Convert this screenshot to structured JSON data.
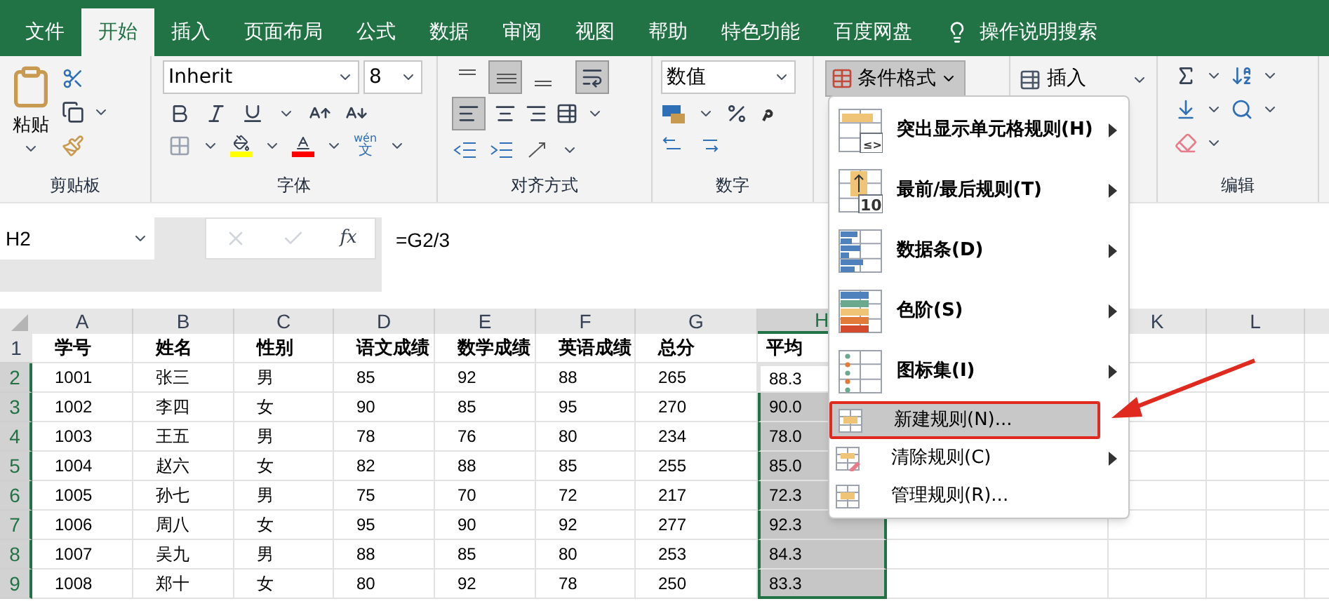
{
  "tabs": [
    {
      "label": "文件",
      "selected": false
    },
    {
      "label": "开始",
      "selected": true
    },
    {
      "label": "插入",
      "selected": false
    },
    {
      "label": "页面布局",
      "selected": false
    },
    {
      "label": "公式",
      "selected": false
    },
    {
      "label": "数据",
      "selected": false
    },
    {
      "label": "审阅",
      "selected": false
    },
    {
      "label": "视图",
      "selected": false
    },
    {
      "label": "帮助",
      "selected": false
    },
    {
      "label": "特色功能",
      "selected": false
    },
    {
      "label": "百度网盘",
      "selected": false
    }
  ],
  "search_hint": "操作说明搜索",
  "ribbon": {
    "clipboard": {
      "paste": "粘贴",
      "label": "剪贴板"
    },
    "font": {
      "name": "Inherit",
      "size": "8",
      "label": "字体",
      "phonetic_top": "wén",
      "phonetic_bottom": "文"
    },
    "alignment": {
      "label": "对齐方式"
    },
    "number": {
      "format": "数值",
      "label": "数字"
    },
    "styles": {
      "conditional_format": "条件格式",
      "open": true
    },
    "cells": {
      "insert": "插入"
    },
    "editing": {
      "label": "编辑"
    }
  },
  "formula_bar": {
    "name_box": "H2",
    "fx": "fx",
    "formula": "=G2/3"
  },
  "sheet": {
    "columns": [
      {
        "label": "A",
        "selected": false
      },
      {
        "label": "B",
        "selected": false
      },
      {
        "label": "C",
        "selected": false
      },
      {
        "label": "D",
        "selected": false
      },
      {
        "label": "E",
        "selected": false
      },
      {
        "label": "F",
        "selected": false
      },
      {
        "label": "G",
        "selected": false
      },
      {
        "label": "H",
        "selected": true
      },
      {
        "label": "K",
        "selected": false
      },
      {
        "label": "L",
        "selected": false
      }
    ],
    "rows": [
      {
        "number": "1",
        "selected": false,
        "active": false,
        "cells": [
          "学号",
          "姓名",
          "性别",
          "语文成绩",
          "数学成绩",
          "英语成绩",
          "总分",
          "平均"
        ]
      },
      {
        "number": "2",
        "selected": true,
        "active": true,
        "cells": [
          "1001",
          "张三",
          "男",
          "85",
          "92",
          "88",
          "265",
          "88.3"
        ]
      },
      {
        "number": "3",
        "selected": true,
        "active": false,
        "cells": [
          "1002",
          "李四",
          "女",
          "90",
          "85",
          "95",
          "270",
          "90.0"
        ]
      },
      {
        "number": "4",
        "selected": true,
        "active": false,
        "cells": [
          "1003",
          "王五",
          "男",
          "78",
          "76",
          "80",
          "234",
          "78.0"
        ]
      },
      {
        "number": "5",
        "selected": true,
        "active": false,
        "cells": [
          "1004",
          "赵六",
          "女",
          "82",
          "88",
          "85",
          "255",
          "85.0"
        ]
      },
      {
        "number": "6",
        "selected": true,
        "active": false,
        "cells": [
          "1005",
          "孙七",
          "男",
          "75",
          "70",
          "72",
          "217",
          "72.3"
        ]
      },
      {
        "number": "7",
        "selected": true,
        "active": false,
        "cells": [
          "1006",
          "周八",
          "女",
          "95",
          "90",
          "92",
          "277",
          "92.3"
        ]
      },
      {
        "number": "8",
        "selected": true,
        "active": false,
        "cells": [
          "1007",
          "吴九",
          "男",
          "88",
          "85",
          "80",
          "253",
          "84.3"
        ]
      },
      {
        "number": "9",
        "selected": true,
        "active": false,
        "cells": [
          "1008",
          "郑十",
          "女",
          "80",
          "92",
          "78",
          "250",
          "83.3"
        ]
      }
    ]
  },
  "menu": {
    "items": [
      {
        "label": "突出显示单元格规则(H)",
        "kind": "large",
        "icon_text": "≤>",
        "submenu": true,
        "highlighted": false
      },
      {
        "label": "最前/最后规则(T)",
        "kind": "large",
        "icon_text": "10",
        "submenu": true,
        "highlighted": false
      },
      {
        "label": "数据条(D)",
        "kind": "large",
        "submenu": true,
        "highlighted": false
      },
      {
        "label": "色阶(S)",
        "kind": "large",
        "submenu": true,
        "highlighted": false
      },
      {
        "label": "图标集(I)",
        "kind": "large",
        "submenu": true,
        "highlighted": false
      },
      {
        "label": "新建规则(N)...",
        "kind": "small",
        "submenu": false,
        "highlighted": true
      },
      {
        "label": "清除规则(C)",
        "kind": "small",
        "submenu": true,
        "highlighted": false
      },
      {
        "label": "管理规则(R)...",
        "kind": "small",
        "submenu": false,
        "highlighted": false
      }
    ]
  }
}
